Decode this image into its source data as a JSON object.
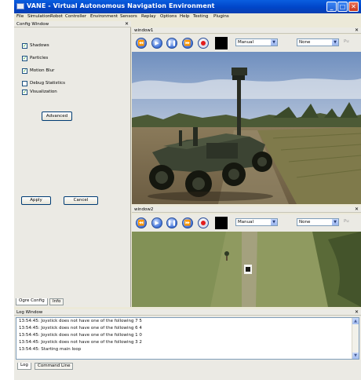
{
  "window": {
    "title": "VANE - Virtual Autonomous Navigation Environment"
  },
  "menu": [
    "File",
    "Simulation",
    "Robot",
    "Controller",
    "Environment",
    "Sensors",
    "Replay",
    "Options",
    "Help",
    "Testing",
    "Plugins"
  ],
  "config": {
    "title": "Config Window",
    "checkboxes": [
      {
        "label": "Shadows",
        "checked": true
      },
      {
        "label": "Particles",
        "checked": true
      },
      {
        "label": "Motion Blur",
        "checked": true
      },
      {
        "label": "Debug Statistics",
        "checked": false
      },
      {
        "label": "Visualization",
        "checked": true
      }
    ],
    "advanced_label": "Advanced",
    "apply_label": "Apply",
    "cancel_label": "Cancel",
    "tabs": [
      "Ogre Config",
      "Info"
    ]
  },
  "window1": {
    "title": "window1",
    "mode": "Manual",
    "camera": "None",
    "extra": "Pu"
  },
  "window2": {
    "title": "window2",
    "mode": "Manual",
    "camera": "None",
    "extra": "Pu"
  },
  "log": {
    "title": "Log Window",
    "lines": [
      "13:54:45: Joystick does not have one of the following 7 5",
      "13:54:45: Joystick does not have one of the following 6 4",
      "13:54:45: Joystick does not have one of the following 1 0",
      "13:54:45: Joystick does not have one of the following 3 2",
      "13:54:45: Starting main loop"
    ],
    "tabs": [
      "Log",
      "Command Line"
    ]
  },
  "colors": {
    "titlebar": "#0045c8",
    "panel": "#ebeae4",
    "record": "#e21c1c"
  }
}
